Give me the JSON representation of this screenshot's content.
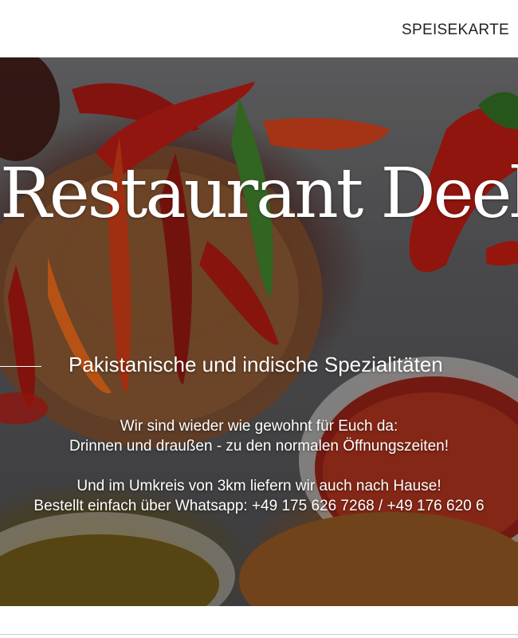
{
  "header": {
    "nav_label": "SPEISEKARTE"
  },
  "hero": {
    "title": "Restaurant Deeba",
    "subtitle": "Pakistanische und indische Spezialitäten",
    "paragraph1": {
      "line1": "Wir sind wieder wie gewohnt für Euch da:",
      "line2": "Drinnen und draußen - zu den normalen Öffnungszeiten!"
    },
    "paragraph2": {
      "line1": "Und im Umkreis von 3km liefern wir auch nach Hause!",
      "line2": "Bestellt einfach über Whatsapp: +49 175 626 7268 / +49 176 620 6"
    },
    "background_image": "chilis-and-spices-photo"
  },
  "colors": {
    "text_on_hero": "#ffffff",
    "nav_text": "#222222",
    "page_background": "#ffffff"
  }
}
